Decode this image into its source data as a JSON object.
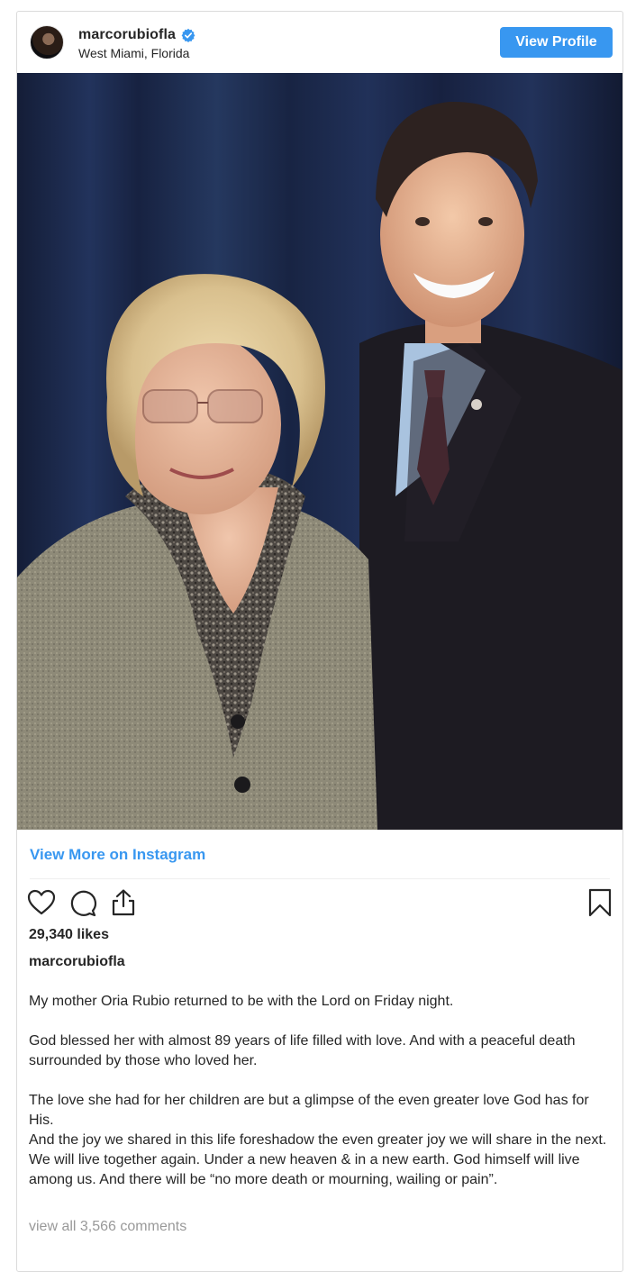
{
  "post": {
    "username": "marcorubiofla",
    "location": "West Miami, Florida",
    "view_profile_label": "View Profile",
    "view_more_label": "View More on Instagram",
    "likes": "29,340 likes",
    "caption_username": "marcorubiofla",
    "caption_lines": [
      "My mother Oria Rubio returned to be with the Lord on Friday night.",
      "God blessed her with almost 89 years of life filled with love. And with a peaceful death surrounded by those who loved her.",
      "The love she had for her children are but a glimpse of the even greater love God has for His.",
      "And the joy we shared in this life foreshadow the even greater joy we will share in the next.",
      "We will live together again. Under a new heaven & in a new earth. God himself will live among us. And there will be “no more death or mourning, wailing or pain”."
    ],
    "view_comments": "view all 3,566 comments"
  },
  "icons": {
    "verified": "verified-badge-icon",
    "heart": "heart-icon",
    "comment": "comment-icon",
    "share": "share-icon",
    "bookmark": "bookmark-icon"
  },
  "colors": {
    "accent": "#3897f0",
    "text": "#262626",
    "muted": "#999999",
    "border": "#dbdbdb"
  }
}
